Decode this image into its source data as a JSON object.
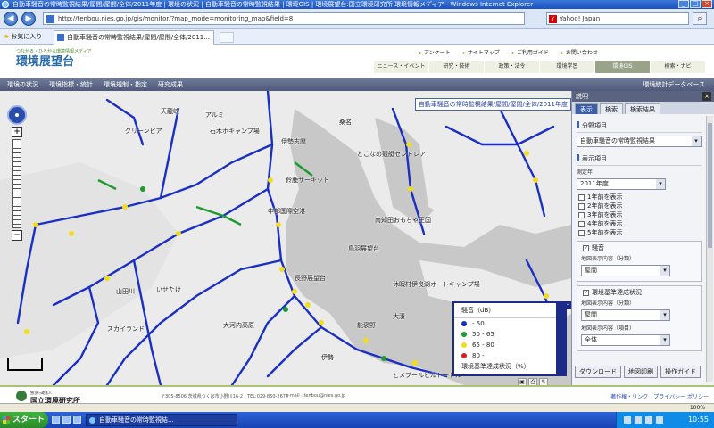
{
  "window": {
    "title": "自動車騒音の常時監視結果/屋間/屋間/全体/2011年度 | 環境の状況 | 自動車騒音の常時監視結果 | 環境GIS | 環境展望台:国立環境研究所 環境情報メディア - Windows Internet Explorer"
  },
  "browser": {
    "url": "http://tenbou.nies.go.jp/gis/monitor/?map_mode=monitoring_map&field=8",
    "search_value": "Yahoo! Japan",
    "favorites_label": "お気に入り",
    "tab_label": "自動車騒音の常時監視結果/屋間/屋間/全体/2011..."
  },
  "site": {
    "tagline": "つながる・ひろがる環境情報メディア",
    "logo": "環境展望台",
    "toplinks": [
      "アンケート",
      "サイトマップ",
      "ご利用ガイド",
      "お問い合わせ"
    ],
    "nav": [
      "ニュース・イベント",
      "研究・技術",
      "政策・法令",
      "環境学習",
      "環境GIS",
      "検索・ナビ"
    ],
    "nav_active": "環境GIS",
    "subnav": [
      "環境の状況",
      "環境指標・統計",
      "環境規制・指定",
      "研究成果"
    ],
    "subnav_right": "環境統計データベース"
  },
  "map": {
    "title": "自動車騒音の常時監視結果/屋間/屋間/全体/2011年度",
    "labels": [
      {
        "text": "天龍峡",
        "name": "place-label"
      },
      {
        "text": "アルミ",
        "name": "place-label"
      },
      {
        "text": "グリーンピア",
        "name": "place-label"
      },
      {
        "text": "石木ホキャンプ場",
        "name": "place-label"
      },
      {
        "text": "伊勢志摩",
        "name": "place-label"
      },
      {
        "text": "鈴鹿サーキット",
        "name": "place-label"
      },
      {
        "text": "中部国際空港",
        "name": "place-label"
      },
      {
        "text": "南知田おもちゃ王国",
        "name": "place-label"
      },
      {
        "text": "鳥羽展望台",
        "name": "place-label"
      },
      {
        "text": "とこなめ競艇セントレア",
        "name": "place-label"
      },
      {
        "text": "休暇村伊良湖オートキャンプ場",
        "name": "place-label"
      },
      {
        "text": "大湊",
        "name": "place-label"
      },
      {
        "text": "桑名",
        "name": "place-label"
      },
      {
        "text": "山田川",
        "name": "place-label"
      },
      {
        "text": "いせたけ",
        "name": "place-label"
      },
      {
        "text": "スカイランド",
        "name": "place-label"
      },
      {
        "text": "大河内高原",
        "name": "place-label"
      },
      {
        "text": "長野展望台",
        "name": "place-label"
      },
      {
        "text": "伊勢",
        "name": "place-label"
      },
      {
        "text": "能褒野",
        "name": "place-label"
      },
      {
        "text": "ヒメプールヒルトートル",
        "name": "place-label"
      }
    ]
  },
  "legend": {
    "title": "騒音（dB）",
    "items": [
      {
        "label": "- 50",
        "color": "#1a2fc4"
      },
      {
        "label": "50 - 65",
        "color": "#1e9b2e"
      },
      {
        "label": "65 - 80",
        "color": "#f2dd1a"
      },
      {
        "label": "80 -",
        "color": "#d71d1d"
      }
    ],
    "footer": "環境基準達成状況（%）"
  },
  "panel": {
    "title": "説明",
    "tabs": [
      "表示",
      "検索",
      "検索結果"
    ],
    "active_tab": "表示",
    "field_section": "分野項目",
    "field_value": "自動車騒音の常時監視結果",
    "display_section": "表示項目",
    "year_label": "測定年",
    "year_value": "2011年度",
    "prev_years": [
      "1年前を表示",
      "2年前を表示",
      "3年前を表示",
      "4年前を表示",
      "5年前を表示"
    ],
    "noise_label": "騒音",
    "noise_sub": "地図表示内容（分類）",
    "noise_value": "屋間",
    "standard_label": "環境基準達成状況",
    "standard_sub1": "地図表示内容（分類）",
    "standard_value1": "屋間",
    "standard_sub2": "地図表示内容（項目）",
    "standard_value2": "全体",
    "buttons": [
      "ダウンロード",
      "地図印刷",
      "操作ガイド"
    ]
  },
  "footer": {
    "org_small": "独立行政法人",
    "org": "国立環境研究所",
    "address": "〒305-8506 茨城県つくば市小野川16-2　TEL:029-850-2674",
    "email": "e-mail : tenbou@nies.go.jp",
    "links": [
      "著作権・リンク",
      "プライバシー ポリシー"
    ]
  },
  "taskbar": {
    "start": "スタート",
    "task": "自動車騒音の常時監視結...",
    "time": "10:55"
  },
  "statusbar": {
    "zoom": "100%"
  }
}
